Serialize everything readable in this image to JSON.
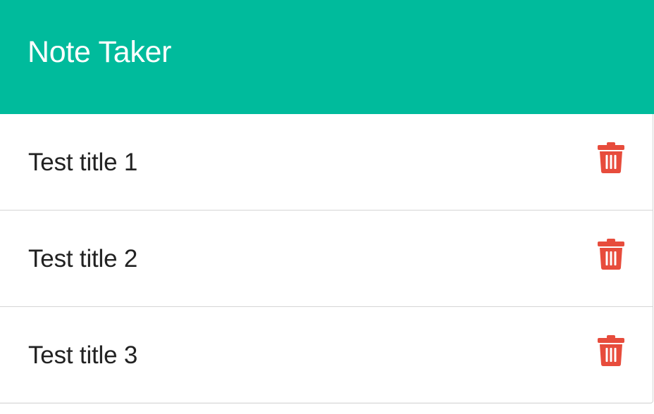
{
  "header": {
    "title": "Note Taker",
    "background_color": "#00bb9c"
  },
  "notes": [
    {
      "title": "Test title 1",
      "delete_icon": "trash-icon"
    },
    {
      "title": "Test title 2",
      "delete_icon": "trash-icon"
    },
    {
      "title": "Test title 3",
      "delete_icon": "trash-icon"
    }
  ],
  "colors": {
    "delete_icon": "#e74c3c",
    "note_text": "#222222"
  }
}
